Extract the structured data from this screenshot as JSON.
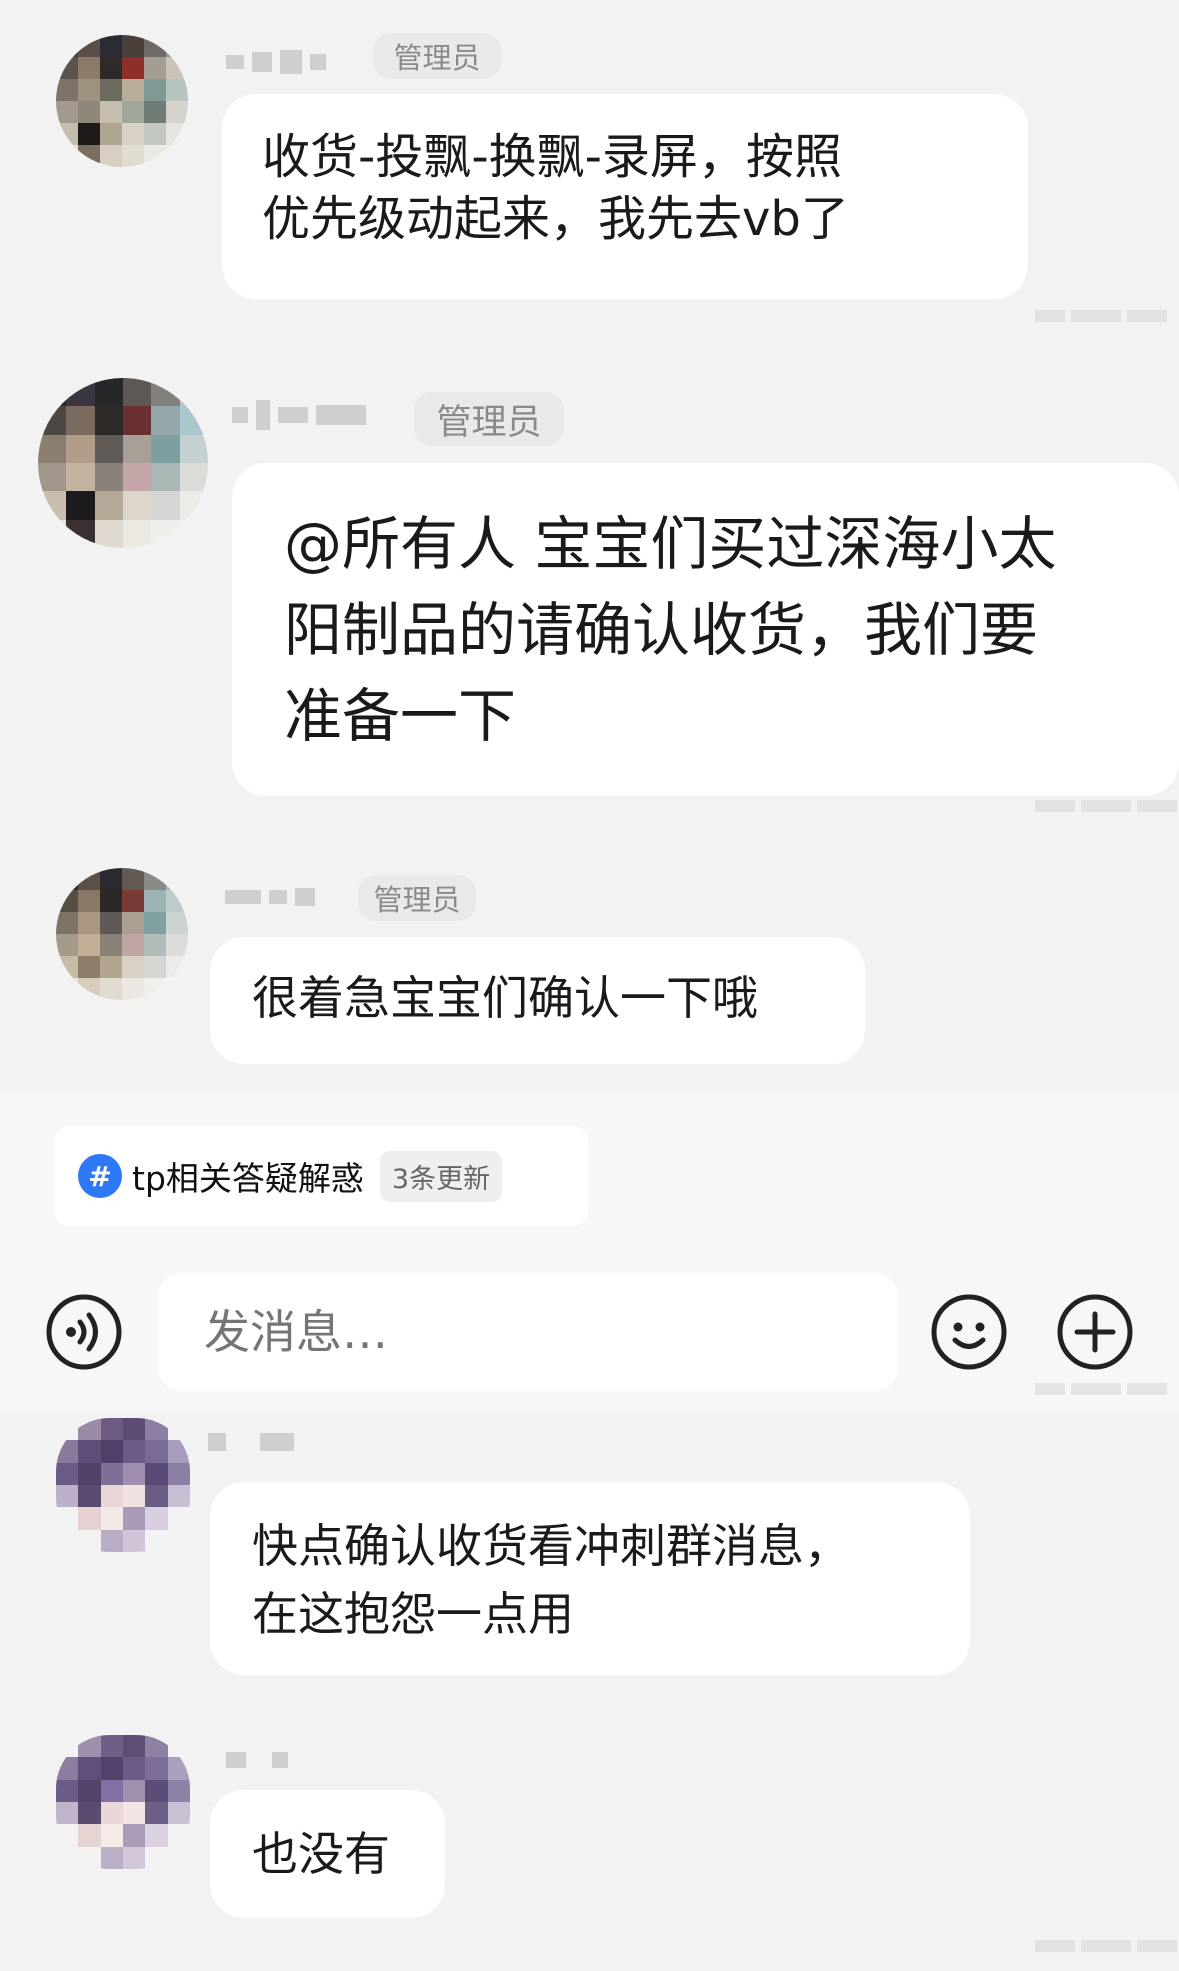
{
  "messages": [
    {
      "badge": "管理员",
      "text": "收货-投飘-换飘-录屏，按照\n优先级动起来，我先去vb了"
    },
    {
      "badge": "管理员",
      "text": "@所有人 宝宝们买过深海小太\n阳制品的请确认收货，我们要\n准备一下"
    },
    {
      "badge": "管理员",
      "text": "很着急宝宝们确认一下哦"
    },
    {
      "badge": "",
      "text": "快点确认收货看冲刺群消息，\n在这抱怨一点用"
    },
    {
      "badge": "",
      "text": "也没有"
    }
  ],
  "topic": {
    "label": "tp相关答疑解惑",
    "updates": "3条更新"
  },
  "composer": {
    "placeholder": "发消息…"
  },
  "icons": {
    "voice": "voice-icon",
    "emoji": "emoji-icon",
    "plus": "plus-icon",
    "topic": "hashtag-icon"
  },
  "colors": {
    "background": "#f2f2f2",
    "bubble": "#ffffff",
    "badge": "#e9e9e9",
    "accent": "#2d78f4"
  }
}
